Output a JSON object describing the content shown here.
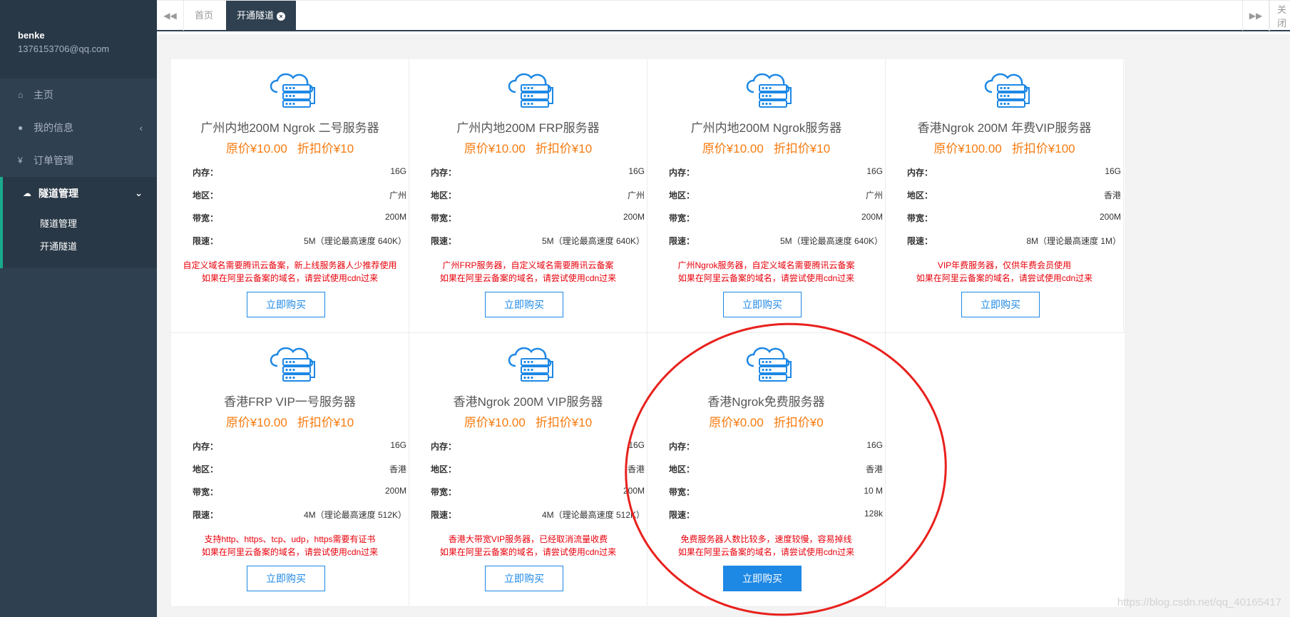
{
  "user": {
    "name": "benke",
    "email": "1376153706@qq.com"
  },
  "nav": [
    {
      "icon": "home-icon",
      "glyph": "⌂",
      "label": "主页"
    },
    {
      "icon": "user-icon",
      "glyph": "●",
      "label": "我的信息",
      "arrow": "‹"
    },
    {
      "icon": "yen-icon",
      "glyph": "¥",
      "label": "订单管理"
    },
    {
      "icon": "cloud-icon",
      "glyph": "☁",
      "label": "隧道管理",
      "arrow": "⌄",
      "active": true
    }
  ],
  "submenu": [
    "隧道管理",
    "开通隧道"
  ],
  "tabs": {
    "back": "◀◀",
    "home": "首页",
    "active": "开通隧道",
    "close": "×",
    "forward": "▶▶",
    "close_label": "关闭"
  },
  "stray_char": "<",
  "buy_label": "立即购买",
  "spec_labels": {
    "memory": "内存：",
    "region": "地区：",
    "bandwidth": "带宽：",
    "limit": "限速："
  },
  "cards": [
    {
      "title": "广州内地200M Ngrok 二号服务器",
      "orig": "原价¥10.00",
      "disc": "折扣价¥10",
      "memory": "16G",
      "region": "广州",
      "bandwidth": "200M",
      "limit": "5M（理论最高速度 640K）",
      "note1": "自定义域名需要腾讯云备案，新上线服务器人少推荐使用",
      "note2": "如果在阿里云备案的域名，请尝试使用cdn过来"
    },
    {
      "title": "广州内地200M FRP服务器",
      "orig": "原价¥10.00",
      "disc": "折扣价¥10",
      "memory": "16G",
      "region": "广州",
      "bandwidth": "200M",
      "limit": "5M（理论最高速度 640K）",
      "note1": "广州FRP服务器，自定义域名需要腾讯云备案",
      "note2": "如果在阿里云备案的域名，请尝试使用cdn过来"
    },
    {
      "title": "广州内地200M Ngrok服务器",
      "orig": "原价¥10.00",
      "disc": "折扣价¥10",
      "memory": "16G",
      "region": "广州",
      "bandwidth": "200M",
      "limit": "5M（理论最高速度 640K）",
      "note1": "广州Ngrok服务器，自定义域名需要腾讯云备案",
      "note2": "如果在阿里云备案的域名，请尝试使用cdn过来"
    },
    {
      "title": "香港Ngrok 200M 年费VIP服务器",
      "orig": "原价¥100.00",
      "disc": "折扣价¥100",
      "memory": "16G",
      "region": "香港",
      "bandwidth": "200M",
      "limit": "8M（理论最高速度 1M）",
      "note1": "VIP年费服务器，仅供年费会员使用",
      "note2": "如果在阿里云备案的域名，请尝试使用cdn过来"
    },
    {
      "title": "香港FRP VIP一号服务器",
      "orig": "原价¥10.00",
      "disc": "折扣价¥10",
      "memory": "16G",
      "region": "香港",
      "bandwidth": "200M",
      "limit": "4M（理论最高速度 512K）",
      "note1": "支持http、https、tcp、udp，https需要有证书",
      "note2": "如果在阿里云备案的域名，请尝试使用cdn过来"
    },
    {
      "title": "香港Ngrok 200M VIP服务器",
      "orig": "原价¥10.00",
      "disc": "折扣价¥10",
      "memory": "16G",
      "region": "香港",
      "bandwidth": "200M",
      "limit": "4M（理论最高速度 512K）",
      "note1": "香港大带宽VIP服务器，已经取消流量收费",
      "note2": "如果在阿里云备案的域名，请尝试使用cdn过来"
    },
    {
      "title": "香港Ngrok免费服务器",
      "orig": "原价¥0.00",
      "disc": "折扣价¥0",
      "memory": "16G",
      "region": "香港",
      "bandwidth": "10 M",
      "limit": "128k",
      "note1": "免费服务器人数比较多，速度较慢，容易掉线",
      "note2": "如果在阿里云备案的域名，请尝试使用cdn过来",
      "primary": true
    }
  ],
  "watermark": "https://blog.csdn.net/qq_40165417"
}
